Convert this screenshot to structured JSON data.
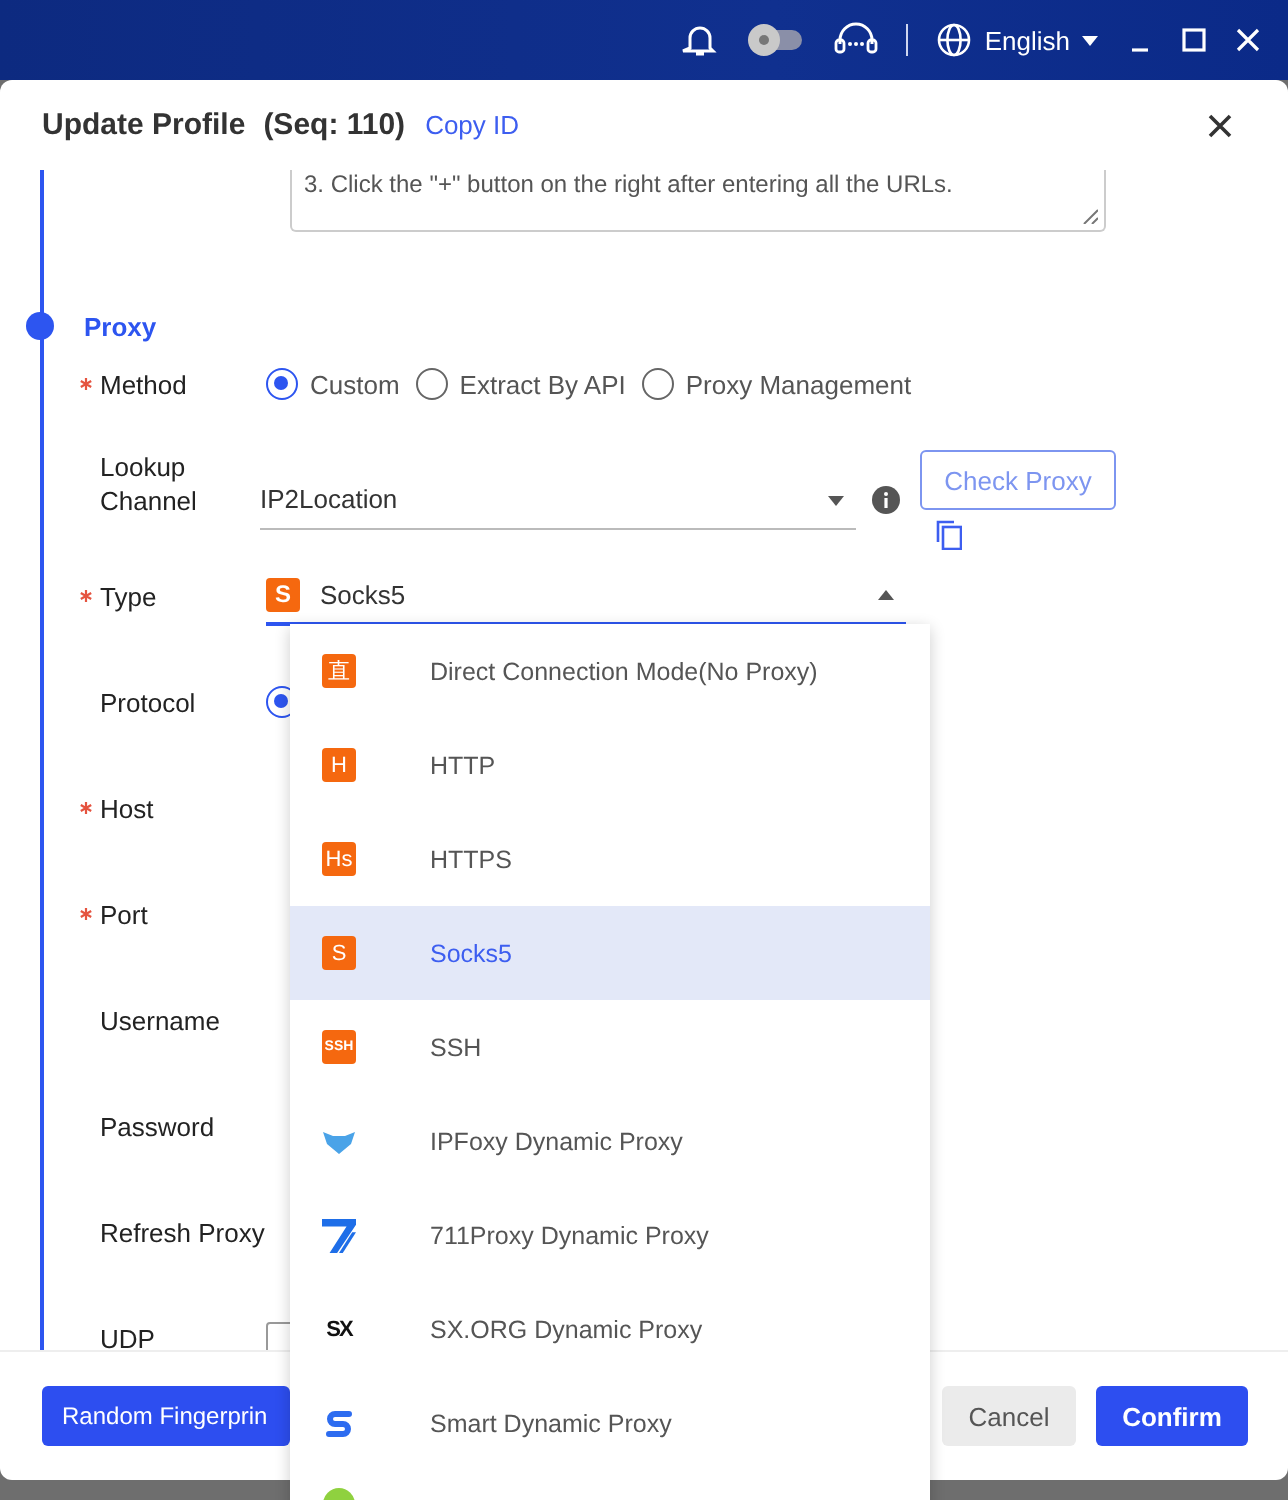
{
  "top_bar": {
    "language": "English"
  },
  "dialog": {
    "title": "Update Profile",
    "seq": "(Seq: 110)",
    "copy_link": "Copy ID"
  },
  "note": "3. Click the \"+\" button on the right after entering all the URLs.",
  "section": "Proxy",
  "method": {
    "label": "Method",
    "required": true,
    "options": [
      {
        "label": "Custom",
        "selected": true
      },
      {
        "label": "Extract By API",
        "selected": false
      },
      {
        "label": "Proxy Management",
        "selected": false
      }
    ]
  },
  "lookup": {
    "label": "Lookup Channel",
    "required": false,
    "value": "IP2Location",
    "button": "Check Proxy"
  },
  "type": {
    "label": "Type",
    "required": true,
    "value": "Socks5",
    "badge": "S",
    "open": true
  },
  "fields": [
    {
      "label": "Protocol",
      "required": false,
      "kind": "radio",
      "checked": true
    },
    {
      "label": "Host",
      "required": true,
      "kind": "blank"
    },
    {
      "label": "Port",
      "required": true,
      "kind": "blank"
    },
    {
      "label": "Username",
      "required": false,
      "kind": "blank"
    },
    {
      "label": "Password",
      "required": false,
      "kind": "blank"
    },
    {
      "label": "Refresh Proxy",
      "required": false,
      "kind": "blank"
    },
    {
      "label": "UDP",
      "required": false,
      "kind": "checkbox",
      "checked": false
    }
  ],
  "dropdown": [
    {
      "label": "Direct Connection Mode(No Proxy)",
      "selected": false,
      "icon": {
        "kind": "badge",
        "text": "直"
      }
    },
    {
      "label": "HTTP",
      "selected": false,
      "icon": {
        "kind": "badge",
        "text": "H"
      }
    },
    {
      "label": "HTTPS",
      "selected": false,
      "icon": {
        "kind": "badge",
        "text": "Hs"
      }
    },
    {
      "label": "Socks5",
      "selected": true,
      "icon": {
        "kind": "badge",
        "text": "S"
      }
    },
    {
      "label": "SSH",
      "selected": false,
      "icon": {
        "kind": "badge",
        "text": "SSH"
      }
    },
    {
      "label": "IPFoxy Dynamic Proxy",
      "selected": false,
      "icon": {
        "kind": "fox"
      }
    },
    {
      "label": "711Proxy Dynamic Proxy",
      "selected": false,
      "icon": {
        "kind": "stripes"
      }
    },
    {
      "label": "SX.ORG Dynamic Proxy",
      "selected": false,
      "icon": {
        "kind": "mono",
        "text": "SX"
      }
    },
    {
      "label": "Smart Dynamic Proxy",
      "selected": false,
      "icon": {
        "kind": "smart"
      }
    },
    {
      "selected": false,
      "icon": {
        "kind": "circle"
      }
    }
  ],
  "footer": {
    "random": "Random Fingerprin",
    "cancel": "Cancel",
    "confirm": "Confirm"
  }
}
